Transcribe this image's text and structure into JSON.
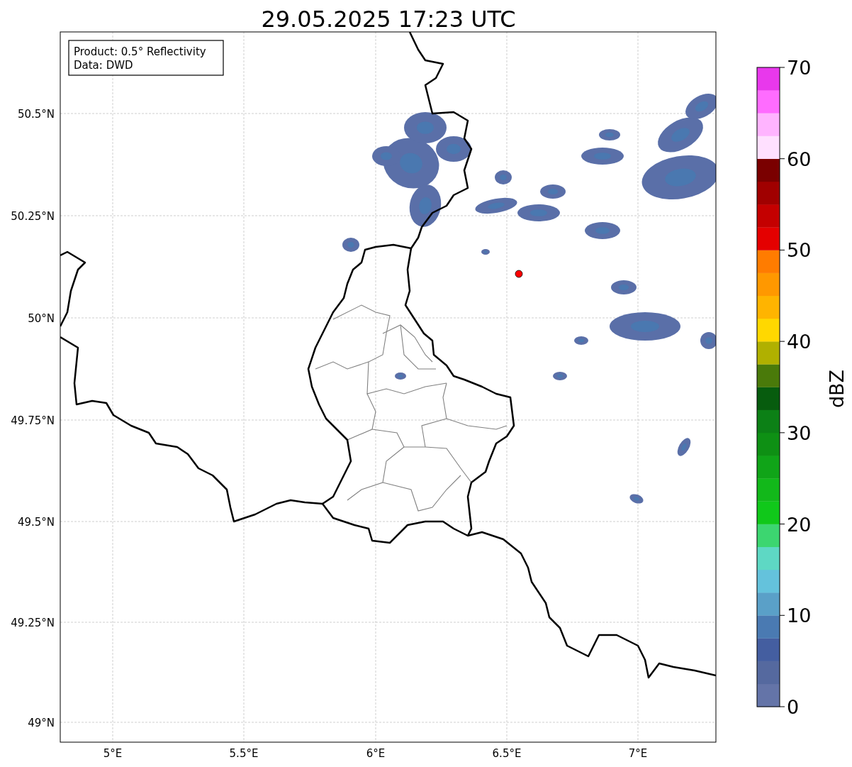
{
  "title": "29.05.2025 17:23 UTC",
  "info_box": {
    "lines": [
      "Product: 0.5° Reflectivity",
      "Data: DWD"
    ]
  },
  "map": {
    "y_ticks": [
      "50.5°N",
      "50.25°N",
      "50°N",
      "49.75°N",
      "49.5°N",
      "49.25°N",
      "49°N"
    ],
    "x_ticks": [
      "5°E",
      "5.5°E",
      "6°E",
      "6.5°E",
      "7°E"
    ]
  },
  "colorbar": {
    "label": "dBZ",
    "ticks": [
      "70",
      "60",
      "50",
      "40",
      "30",
      "20",
      "10",
      "0"
    ],
    "bins": [
      {
        "color": "#6474a8"
      },
      {
        "color": "#55699f"
      },
      {
        "color": "#445ea0"
      },
      {
        "color": "#4a7ab2"
      },
      {
        "color": "#5aa0c8"
      },
      {
        "color": "#64c2dc"
      },
      {
        "color": "#5ed8c4"
      },
      {
        "color": "#3cd670"
      },
      {
        "color": "#10c81a"
      },
      {
        "color": "#12b81a"
      },
      {
        "color": "#10a418"
      },
      {
        "color": "#0e9014"
      },
      {
        "color": "#0c8016"
      },
      {
        "color": "#075c0e"
      },
      {
        "color": "#4a7a0a"
      },
      {
        "color": "#b0b000"
      },
      {
        "color": "#ffd800"
      },
      {
        "color": "#ffb400"
      },
      {
        "color": "#ff9800"
      },
      {
        "color": "#ff7c00"
      },
      {
        "color": "#e40000"
      },
      {
        "color": "#c40000"
      },
      {
        "color": "#a00000"
      },
      {
        "color": "#7a0000"
      },
      {
        "color": "#ffe0ff"
      },
      {
        "color": "#ffb4ff"
      },
      {
        "color": "#ff6cff"
      },
      {
        "color": "#e838ec"
      }
    ]
  }
}
